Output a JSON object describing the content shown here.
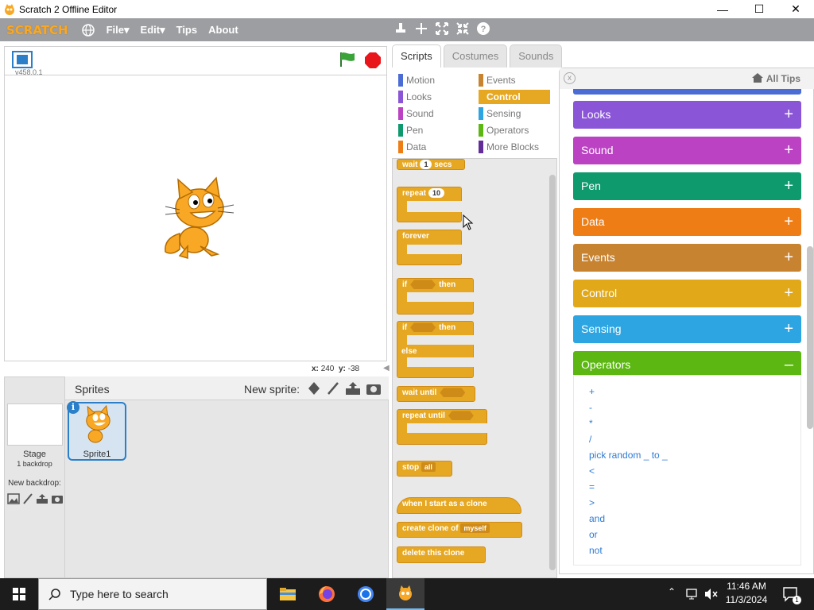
{
  "window": {
    "title": "Scratch 2 Offline Editor",
    "minimize": "—",
    "maximize": "☐",
    "close": "✕"
  },
  "menubar": {
    "logo": "SCRATCH",
    "items": [
      "File▾",
      "Edit▾",
      "Tips",
      "About"
    ]
  },
  "stage": {
    "version": "v458.0.1",
    "x_label": "x:",
    "x_value": "240",
    "y_label": "y:",
    "y_value": "-38"
  },
  "sprites": {
    "header": "Sprites",
    "new_sprite_label": "New sprite:",
    "stage_label": "Stage",
    "stage_backdrops": "1 backdrop",
    "new_backdrop_label": "New backdrop:",
    "sprite1_name": "Sprite1"
  },
  "tabs": [
    "Scripts",
    "Costumes",
    "Sounds"
  ],
  "categories": {
    "left": [
      {
        "label": "Motion",
        "color": "#4a6cd4"
      },
      {
        "label": "Looks",
        "color": "#8a55d7"
      },
      {
        "label": "Sound",
        "color": "#bb42c3"
      },
      {
        "label": "Pen",
        "color": "#0e9a6c"
      },
      {
        "label": "Data",
        "color": "#ee7d16"
      }
    ],
    "right": [
      {
        "label": "Events",
        "color": "#c88330"
      },
      {
        "label": "Control",
        "color": "#e6a822"
      },
      {
        "label": "Sensing",
        "color": "#2ca5e2"
      },
      {
        "label": "Operators",
        "color": "#5cb712"
      },
      {
        "label": "More Blocks",
        "color": "#632d99"
      }
    ],
    "selected": "Control"
  },
  "blocks": {
    "wait": "wait",
    "wait_val": "1",
    "wait_suffix": "secs",
    "repeat": "repeat",
    "repeat_val": "10",
    "forever": "forever",
    "if": "if",
    "then": "then",
    "if2": "if",
    "then2": "then",
    "else": "else",
    "wait_until": "wait until",
    "repeat_until": "repeat until",
    "stop": "stop",
    "stop_val": "all",
    "clone_hat": "when I start as a clone",
    "create_clone": "create clone of",
    "create_clone_val": "myself",
    "delete_clone": "delete this clone"
  },
  "tips": {
    "close": "x",
    "all_tips": "All Tips",
    "categories": [
      {
        "label": "Looks",
        "color": "#8a55d7",
        "sign": "+"
      },
      {
        "label": "Sound",
        "color": "#bb42c3",
        "sign": "+"
      },
      {
        "label": "Pen",
        "color": "#0e9a6c",
        "sign": "+"
      },
      {
        "label": "Data",
        "color": "#ee7d16",
        "sign": "+"
      },
      {
        "label": "Events",
        "color": "#c88330",
        "sign": "+"
      },
      {
        "label": "Control",
        "color": "#e1a91a",
        "sign": "+"
      },
      {
        "label": "Sensing",
        "color": "#2ca5e2",
        "sign": "+"
      },
      {
        "label": "Operators",
        "color": "#5cb712",
        "sign": "–"
      }
    ],
    "operators": [
      "+",
      "-",
      "*",
      "/",
      "pick random _ to _",
      "<",
      "=",
      ">",
      "and",
      "or",
      "not"
    ]
  },
  "taskbar": {
    "search_placeholder": "Type here to search",
    "time": "11:46 AM",
    "date": "11/3/2024",
    "notifications": "1"
  }
}
